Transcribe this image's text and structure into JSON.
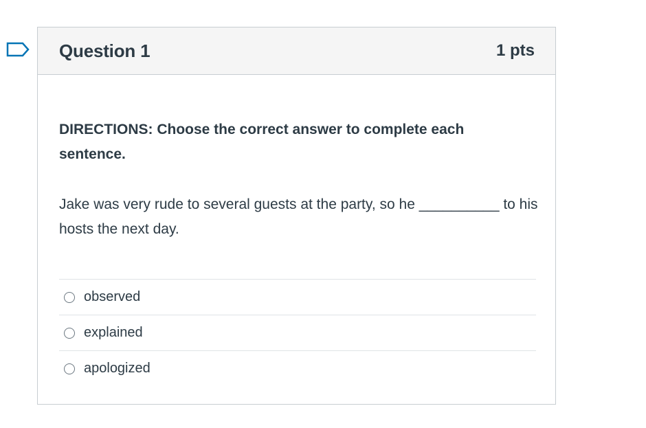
{
  "question": {
    "title": "Question 1",
    "points": "1 pts",
    "directions": "DIRECTIONS: Choose the correct answer to complete each sentence.",
    "prompt": "Jake was very rude to several guests at the party, so he __________ to his hosts the next day.",
    "answers": [
      {
        "label": "observed"
      },
      {
        "label": "explained"
      },
      {
        "label": "apologized"
      }
    ]
  },
  "colors": {
    "header_bg": "#f5f5f5",
    "text": "#2d3b45",
    "border": "#c7cdd1",
    "flag": "#0374b5"
  },
  "icons": {
    "flag": "flag-question-icon",
    "radio": "radio-unselected-icon"
  }
}
